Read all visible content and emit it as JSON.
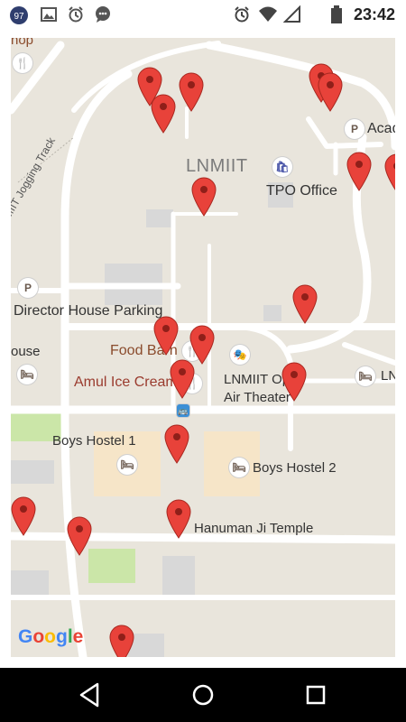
{
  "status_bar": {
    "badge": "97",
    "time": "23:42",
    "icons": [
      "notification-badge-icon",
      "image-icon",
      "alarm-icon",
      "chat-icon",
      "alarm-icon",
      "wifi-icon",
      "signal-icon",
      "battery-icon"
    ]
  },
  "map": {
    "labels": {
      "shop": "hop",
      "lnmiit": "LNMIIT",
      "tpo": "TPO Office",
      "aca": "Acad",
      "jogging": "LNMIIT Jogging Track",
      "director": "Director House Parking",
      "house": "ouse",
      "food_barn": "Food Barn",
      "amul": "Amul Ice Cream",
      "lnmiit_open_air": "LNMIIT Open",
      "air_theater": "Air Theater",
      "lni_right": "LN",
      "boys_hostel_1": "Boys Hostel 1",
      "boys_hostel_2": "Boys Hostel 2",
      "hanuman": "Hanuman Ji Temple"
    },
    "poi_glyphs": {
      "parking": "P",
      "restaurant": "🍴",
      "bed": "🛏",
      "theater": "🎭",
      "shopping": "🛍",
      "bus": "🚌"
    },
    "google_logo": "Google",
    "colors": {
      "map_bg": "#e9e5dc",
      "road": "#ffffff",
      "pin": "#e8423a",
      "building_highlight": "#f6e5c8",
      "park": "#cbe6a8"
    }
  },
  "nav": {
    "back": "back-icon",
    "home": "home-icon",
    "recents": "recents-icon"
  }
}
